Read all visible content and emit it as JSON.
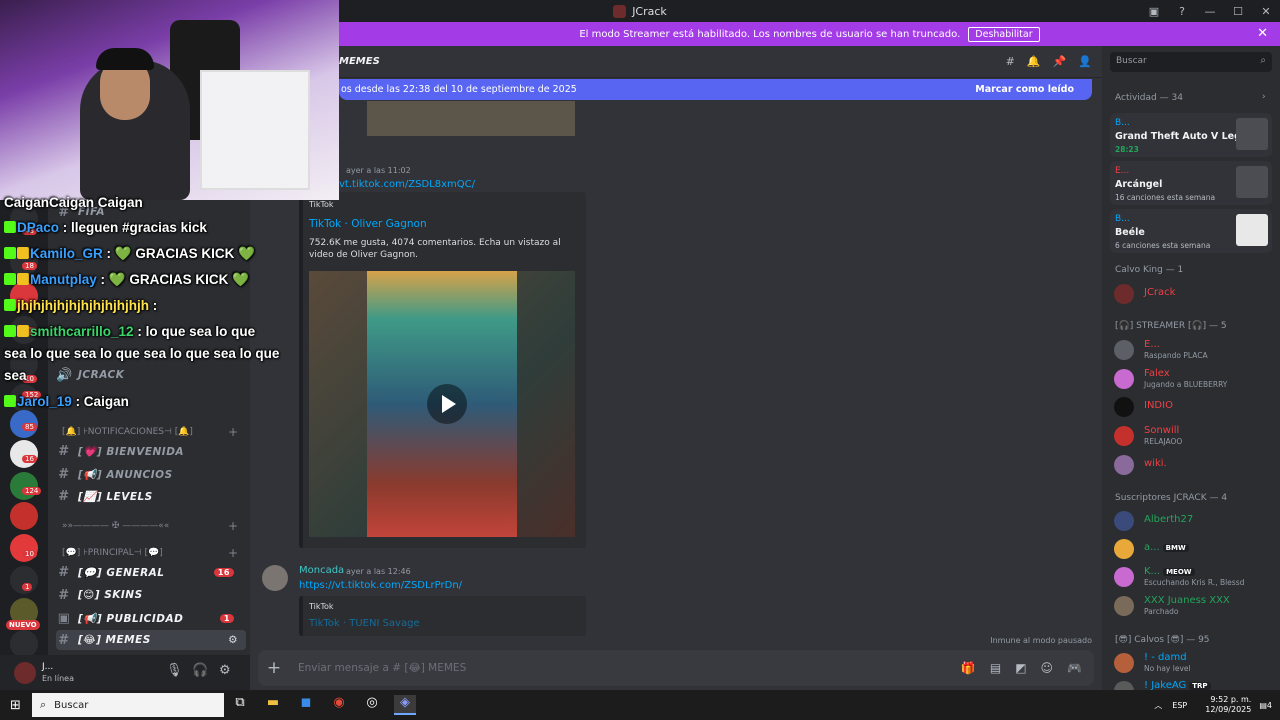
{
  "window": {
    "title": "JCrack"
  },
  "banner": {
    "text": "El modo Streamer está habilitado. Los nombres de usuario se han truncado.",
    "button": "Deshabilitar"
  },
  "channel_header": {
    "name": "MEMES",
    "new_messages": "os desde las 22:38 del 10 de septiembre de 2025",
    "mark_read": "Marcar como leído"
  },
  "sidebar": {
    "categories": {
      "fifa": "FIFA",
      "notifications": "[🔔] ⊦NOTIFICACIONES⊣ [🔔]",
      "principal": "[💬] ⊦PRINCIPAL⊣ [💬]",
      "divider": "»»———— ✠ ————««"
    },
    "channels": [
      {
        "name": "JCRACK",
        "count": ""
      },
      {
        "name": "[💗] BIENVENIDA",
        "count": ""
      },
      {
        "name": "[📢] ANUNCIOS",
        "count": ""
      },
      {
        "name": "[📈] LEVELS",
        "count": ""
      },
      {
        "name": "[💬] GENERAL",
        "count": "16"
      },
      {
        "name": "[😊] SKINS",
        "count": ""
      },
      {
        "name": "[📢] PUBLICIDAD",
        "count": "1"
      },
      {
        "name": "[😂] MEMES",
        "count": ""
      }
    ],
    "server_badges": [
      "43",
      "18",
      "63",
      "10",
      "152",
      "85",
      "16",
      "124",
      "10",
      "1"
    ],
    "nuevo": "NUEVO"
  },
  "user_panel": {
    "name": "J...",
    "status": "En línea"
  },
  "messages": [
    {
      "timestamp": "ayer a las 11:02",
      "link": "vt.tiktok.com/ZSDL8xmQC/",
      "embed_provider": "TikTok",
      "embed_title": "TikTok · Oliver Gagnon",
      "embed_desc": "752.6K me gusta, 4074 comentarios. Echa un vistazo al video de Oliver Gagnon."
    },
    {
      "author": "Moncada",
      "timestamp": "ayer a las 12:46",
      "link": "https://vt.tiktok.com/ZSDLrPrDn/",
      "embed_provider": "TikTok",
      "embed_title": "TikTok · TUENI Savage"
    }
  ],
  "composer": {
    "immune": "Inmune al modo pausado",
    "placeholder": "Enviar mensaje a # [😂] MEMES"
  },
  "members": {
    "search_placeholder": "Buscar",
    "activity_header": "Actividad — 34",
    "activities": [
      {
        "user": "B...",
        "game": "Grand Theft Auto V Legacy",
        "status": "28:23"
      },
      {
        "user": "E...",
        "game": "Arcángel",
        "status": "16 canciones esta semana"
      },
      {
        "user": "B...",
        "game": "Beéle",
        "status": "6 canciones esta semana"
      }
    ],
    "groups": [
      {
        "header": "Calvo King — 1",
        "items": [
          {
            "name": "JCrack",
            "status": ""
          }
        ]
      },
      {
        "header": "[🎧] STREAMER [🎧] — 5",
        "items": [
          {
            "name": "E...",
            "status": "Raspando PLACA"
          },
          {
            "name": "Falex",
            "status": "Jugando a BLUEBERRY"
          },
          {
            "name": "INDIO",
            "status": ""
          },
          {
            "name": "Sonwill",
            "status": "RELAJAOO"
          },
          {
            "name": "wiki.",
            "status": ""
          }
        ]
      },
      {
        "header": "Suscriptores JCRACK — 4",
        "items": [
          {
            "name": "Alberth27",
            "status": ""
          },
          {
            "name": "a...",
            "status": "",
            "tag": "BMW"
          },
          {
            "name": "K...",
            "status": "Escuchando Kris R., Blessd",
            "tag": "MEOW"
          },
          {
            "name": "XXX Juaness XXX",
            "status": "Parchado"
          }
        ]
      },
      {
        "header": "[😎] Calvos [😎] — 95",
        "items": [
          {
            "name": "! - damd",
            "status": "No hay level"
          },
          {
            "name": "! JakeAG",
            "status": "",
            "tag": "TRP"
          }
        ]
      }
    ]
  },
  "kick_chat": [
    {
      "user": "",
      "msg": "CaiganCaigan Caigan"
    },
    {
      "user": "DPaco",
      "msg": ": lleguen #gracias kick"
    },
    {
      "user": "Kamilo_GR",
      "msg": ": 💚 GRACIAS KICK 💚"
    },
    {
      "user": "Manutplay",
      "msg": ": 💚 GRACIAS KICK 💚"
    },
    {
      "user": "jhjhjhjhjhjhjhjhjhjhjh",
      "msg": ":"
    },
    {
      "user": "smithcarrillo_12",
      "msg": ": lo que sea lo que"
    },
    {
      "user": "",
      "msg": "sea lo que sea lo que sea lo que sea lo que"
    },
    {
      "user": "",
      "msg": "sea"
    },
    {
      "user": "Jarol_19",
      "msg": ": Caigan"
    }
  ],
  "taskbar": {
    "search": "Buscar",
    "lang": "ESP",
    "time": "9:52 p. m.",
    "date": "12/09/2025",
    "notif": "4"
  },
  "colors": {
    "banner": "#a33ce7",
    "blurple": "#5865f2",
    "link": "#00a8fc",
    "streamer_red": "#f23f43"
  }
}
